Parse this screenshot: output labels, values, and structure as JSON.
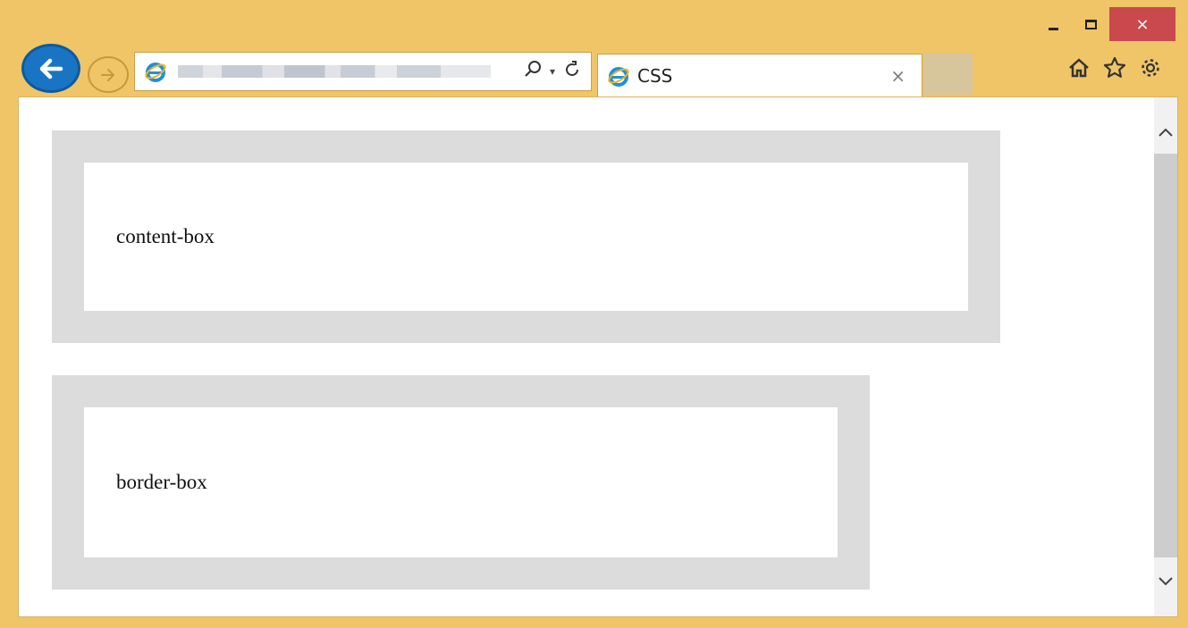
{
  "tab": {
    "label": "CSS",
    "close": "×"
  },
  "window": {
    "close": "×"
  },
  "content": {
    "box1_label": "content-box",
    "box2_label": "border-box"
  },
  "colors": {
    "frame": "#f0c567",
    "close_button": "#c9494d",
    "back_button": "#1975c4",
    "box_border": "#dcdcdc"
  }
}
